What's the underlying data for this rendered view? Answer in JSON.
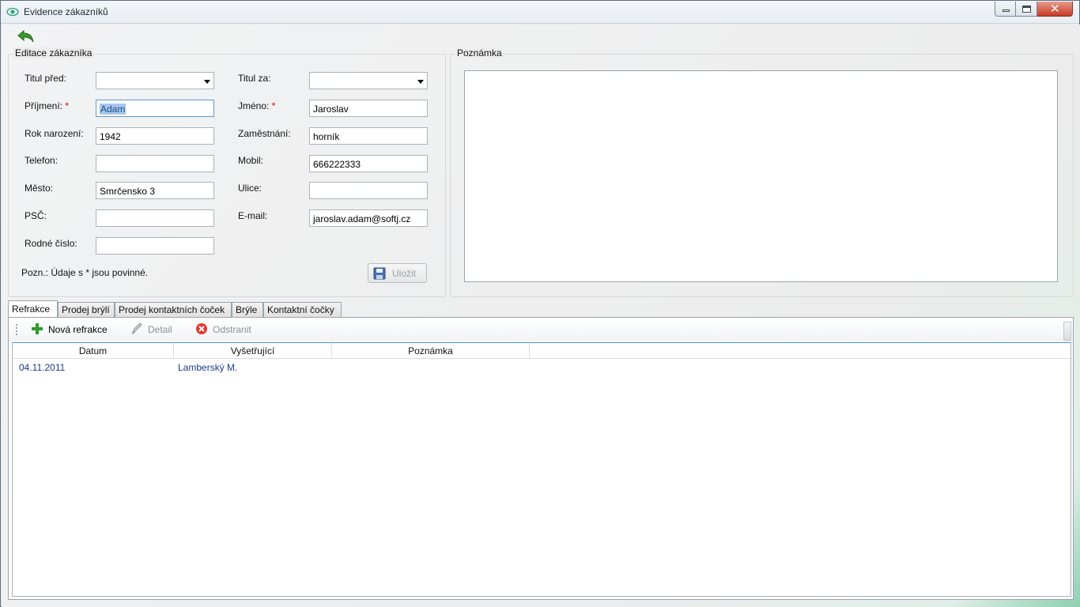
{
  "window": {
    "title": "Evidence zákazníků",
    "close_glyph": "✕"
  },
  "edit_group": {
    "title": "Editace zákazníka",
    "fields": {
      "titul_pred": {
        "label": "Titul před:",
        "value": ""
      },
      "titul_za": {
        "label": "Titul za:",
        "value": ""
      },
      "prijmeni": {
        "label": "Příjmení:",
        "value": "Adam"
      },
      "jmeno": {
        "label": "Jméno:",
        "value": "Jaroslav"
      },
      "rok_narozeni": {
        "label": "Rok narození:",
        "value": "1942"
      },
      "zamestnani": {
        "label": "Zaměstnání:",
        "value": "horník"
      },
      "telefon": {
        "label": "Telefon:",
        "value": ""
      },
      "mobil": {
        "label": "Mobil:",
        "value": "666222333"
      },
      "mesto": {
        "label": "Město:",
        "value": "Smrčensko 3"
      },
      "ulice": {
        "label": "Ulice:",
        "value": ""
      },
      "psc": {
        "label": "PSČ:",
        "value": ""
      },
      "email": {
        "label": "E-mail:",
        "value": "jaroslav.adam@softj.cz"
      },
      "rodne_cislo": {
        "label": "Rodné číslo:",
        "value": ""
      }
    },
    "required_mark": "*",
    "note": "Pozn.: Údaje s * jsou povinné.",
    "save_label": "Uložit"
  },
  "note_group": {
    "title": "Poznámka",
    "value": ""
  },
  "tabs": [
    {
      "label": "Refrakce"
    },
    {
      "label": "Prodej brýlí"
    },
    {
      "label": "Prodej kontaktních čoček"
    },
    {
      "label": "Brýle"
    },
    {
      "label": "Kontaktní čočky"
    }
  ],
  "sub_toolbar": {
    "new_label": "Nová refrakce",
    "detail_label": "Detail",
    "delete_label": "Odstranit"
  },
  "grid": {
    "columns": [
      "Datum",
      "Vyšetřující",
      "Poznámka"
    ],
    "rows": [
      {
        "datum": "04.11.2011",
        "vysetrujici": "Lamberský M.",
        "poznamka": ""
      }
    ]
  }
}
